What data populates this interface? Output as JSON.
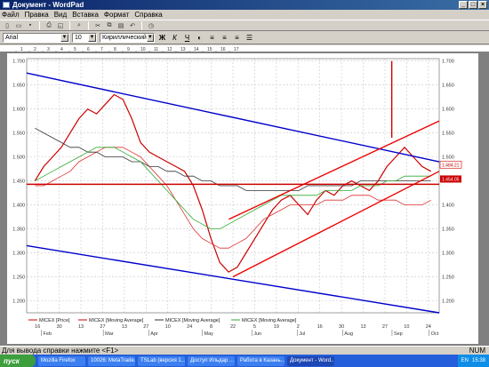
{
  "window": {
    "title": "Документ - WordPad"
  },
  "menu": [
    "Файл",
    "Правка",
    "Вид",
    "Вставка",
    "Формат",
    "Справка"
  ],
  "toolbar": {
    "font_name": "Arial",
    "font_size": "10",
    "charset": "Кириллический"
  },
  "ruler": {
    "marks": [
      "1",
      "2",
      "3",
      "4",
      "5",
      "6",
      "7",
      "8",
      "9",
      "10",
      "11",
      "12",
      "13",
      "14",
      "15",
      "16",
      "17"
    ]
  },
  "chart_data": {
    "type": "line",
    "title": "",
    "ylim": [
      1.175,
      1.705
    ],
    "yticks_left": [
      "1.700",
      "1.650",
      "1.600",
      "1.550",
      "1.500",
      "1.450",
      "1.400",
      "1.350",
      "1.300",
      "1.250",
      "1.200"
    ],
    "yticks_right": [
      "1.700",
      "1.650",
      "1.600",
      "1.550",
      "1.500",
      "1.450",
      "1.400",
      "1.350",
      "1.300",
      "1.250",
      "1.200"
    ],
    "ytick_values": [
      1.7,
      1.65,
      1.6,
      1.55,
      1.5,
      1.45,
      1.4,
      1.35,
      1.3,
      1.25,
      1.2
    ],
    "x_day_labels": [
      "16",
      "30",
      "13",
      "27",
      "13",
      "27",
      "10",
      "24",
      "8",
      "22",
      "5",
      "19",
      "2",
      "16",
      "30",
      "13",
      "27",
      "10",
      "24"
    ],
    "x_month_labels": [
      "Feb",
      "Mar",
      "Apr",
      "May",
      "Jun",
      "Jul",
      "Aug",
      "Sep",
      "Oct"
    ],
    "x_month_positions": [
      0.04,
      0.19,
      0.3,
      0.43,
      0.55,
      0.66,
      0.77,
      0.89,
      0.98
    ],
    "price_label_1": "1.484.21",
    "price_label_2": "1.454.05",
    "legend": [
      {
        "name": "MICEX [Price]",
        "color": "#cc0000"
      },
      {
        "name": "MICEX [Moving Average]",
        "color": "#cc0000"
      },
      {
        "name": "MICEX [Moving Average]",
        "color": "#333333"
      },
      {
        "name": "MICEX [Moving Average]",
        "color": "#33aa33"
      }
    ],
    "series": [
      {
        "name": "MICEX [Price]",
        "values": [
          1.45,
          1.48,
          1.5,
          1.52,
          1.55,
          1.58,
          1.6,
          1.59,
          1.61,
          1.63,
          1.62,
          1.58,
          1.53,
          1.51,
          1.5,
          1.49,
          1.48,
          1.47,
          1.44,
          1.39,
          1.33,
          1.28,
          1.26,
          1.27,
          1.3,
          1.33,
          1.36,
          1.39,
          1.41,
          1.42,
          1.4,
          1.38,
          1.41,
          1.43,
          1.42,
          1.44,
          1.45,
          1.44,
          1.43,
          1.45,
          1.48,
          1.5,
          1.52,
          1.5,
          1.48,
          1.47
        ]
      },
      {
        "name": "MICEX [Moving Average]",
        "values": [
          1.44,
          1.44,
          1.45,
          1.46,
          1.47,
          1.49,
          1.5,
          1.51,
          1.52,
          1.52,
          1.52,
          1.51,
          1.5,
          1.48,
          1.46,
          1.44,
          1.41,
          1.38,
          1.35,
          1.33,
          1.32,
          1.31,
          1.31,
          1.32,
          1.33,
          1.35,
          1.37,
          1.38,
          1.39,
          1.4,
          1.4,
          1.4,
          1.4,
          1.41,
          1.41,
          1.41,
          1.42,
          1.42,
          1.42,
          1.41,
          1.41,
          1.41,
          1.4,
          1.4,
          1.4,
          1.41
        ]
      },
      {
        "name": "MICEX [Moving Average]",
        "values": [
          1.56,
          1.55,
          1.54,
          1.53,
          1.52,
          1.52,
          1.51,
          1.51,
          1.5,
          1.5,
          1.5,
          1.49,
          1.49,
          1.48,
          1.48,
          1.47,
          1.47,
          1.46,
          1.46,
          1.45,
          1.45,
          1.44,
          1.44,
          1.44,
          1.43,
          1.43,
          1.43,
          1.43,
          1.43,
          1.43,
          1.43,
          1.44,
          1.44,
          1.44,
          1.44,
          1.44,
          1.44,
          1.45,
          1.45,
          1.45,
          1.45,
          1.45,
          1.45,
          1.45,
          1.45,
          1.45
        ]
      },
      {
        "name": "MICEX [Moving Average]",
        "values": [
          1.45,
          1.46,
          1.47,
          1.48,
          1.49,
          1.5,
          1.51,
          1.52,
          1.52,
          1.52,
          1.51,
          1.5,
          1.49,
          1.47,
          1.45,
          1.43,
          1.41,
          1.39,
          1.37,
          1.36,
          1.35,
          1.35,
          1.36,
          1.37,
          1.38,
          1.39,
          1.4,
          1.41,
          1.42,
          1.42,
          1.42,
          1.42,
          1.42,
          1.43,
          1.43,
          1.43,
          1.43,
          1.44,
          1.44,
          1.44,
          1.45,
          1.45,
          1.46,
          1.46,
          1.46,
          1.46
        ]
      }
    ],
    "trendlines": [
      {
        "color": "#0000cc",
        "points": [
          [
            0.0,
            1.675
          ],
          [
            1.0,
            1.49
          ]
        ]
      },
      {
        "color": "#0000cc",
        "points": [
          [
            0.0,
            1.315
          ],
          [
            1.0,
            1.175
          ]
        ]
      },
      {
        "color": "#ee0000",
        "points": [
          [
            0.5,
            1.25
          ],
          [
            1.0,
            1.47
          ]
        ]
      },
      {
        "color": "#ee0000",
        "points": [
          [
            0.49,
            1.37
          ],
          [
            1.0,
            1.575
          ]
        ]
      },
      {
        "color": "#cc0000",
        "points": [
          [
            0.0,
            1.443
          ],
          [
            1.0,
            1.443
          ]
        ]
      },
      {
        "color": "#cc0000",
        "points": [
          [
            0.885,
            1.54
          ],
          [
            0.885,
            1.7
          ]
        ]
      }
    ]
  },
  "status": {
    "left": "Для вывода справки нажмите <F1>",
    "right": "NUM"
  },
  "taskbar": {
    "start": "пуск",
    "tasks": [
      "Mozilla Firefox",
      "10026: MetaTrade...",
      "TSLab (версия 1....",
      "Доступ Ильдар ...",
      "Работа в Казань...",
      "Документ - Word..."
    ],
    "active_task": 5,
    "lang": "EN",
    "clock": "15:38"
  }
}
